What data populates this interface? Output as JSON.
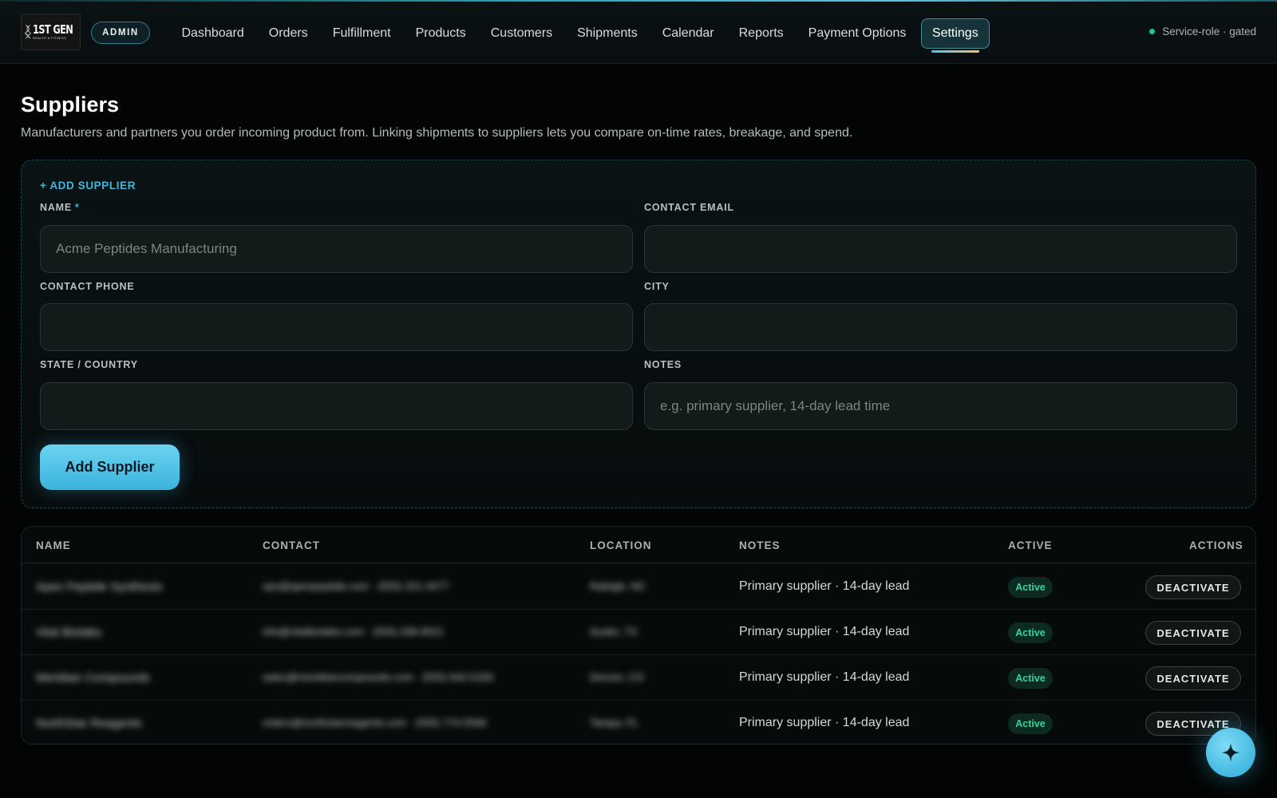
{
  "header": {
    "logo_text": "1ST GEN",
    "logo_sub": "HEALTH & FITNESS",
    "admin_badge": "ADMIN",
    "nav": [
      {
        "label": "Dashboard"
      },
      {
        "label": "Orders"
      },
      {
        "label": "Fulfillment"
      },
      {
        "label": "Products"
      },
      {
        "label": "Customers"
      },
      {
        "label": "Shipments"
      },
      {
        "label": "Calendar"
      },
      {
        "label": "Reports"
      },
      {
        "label": "Payment Options"
      },
      {
        "label": "Settings",
        "active": true
      }
    ],
    "service_status": "Service-role · gated"
  },
  "page": {
    "title": "Suppliers",
    "description": "Manufacturers and partners you order incoming product from. Linking shipments to suppliers lets you compare on-time rates, breakage, and spend."
  },
  "add_form": {
    "heading": "+ ADD SUPPLIER",
    "fields": {
      "name": {
        "label": "NAME",
        "required_mark": "*",
        "placeholder": "Acme Peptides Manufacturing",
        "value": ""
      },
      "contact_email": {
        "label": "CONTACT EMAIL",
        "placeholder": "",
        "value": ""
      },
      "contact_phone": {
        "label": "CONTACT PHONE",
        "placeholder": "",
        "value": ""
      },
      "city": {
        "label": "CITY",
        "placeholder": "",
        "value": ""
      },
      "state_country": {
        "label": "STATE / COUNTRY",
        "placeholder": "",
        "value": ""
      },
      "notes": {
        "label": "NOTES",
        "placeholder": "e.g. primary supplier, 14-day lead time",
        "value": ""
      }
    },
    "submit_label": "Add Supplier"
  },
  "table": {
    "columns": [
      "NAME",
      "CONTACT",
      "LOCATION",
      "NOTES",
      "ACTIVE",
      "ACTIONS"
    ],
    "rows": [
      {
        "name": "Apex Peptide Synthesis",
        "contact": "ops@apexpeptide.com · (555) 201-4477",
        "location": "Raleigh, NC",
        "notes": "Primary supplier · 14-day lead",
        "active": "Active",
        "action": "DEACTIVATE"
      },
      {
        "name": "Vital Biolabs",
        "contact": "info@vitalbiolabs.com · (555) 338-9021",
        "location": "Austin, TX",
        "notes": "Primary supplier · 14-day lead",
        "active": "Active",
        "action": "DEACTIVATE"
      },
      {
        "name": "Meridian Compounds",
        "contact": "sales@meridiancompounds.com · (555) 642-0183",
        "location": "Denver, CO",
        "notes": "Primary supplier · 14-day lead",
        "active": "Active",
        "action": "DEACTIVATE"
      },
      {
        "name": "NorthStar Reagents",
        "contact": "orders@northstarreagents.com · (555) 774-5566",
        "location": "Tampa, FL",
        "notes": "Primary supplier · 14-day lead",
        "active": "Active",
        "action": "DEACTIVATE"
      }
    ]
  },
  "colors": {
    "accent": "#3fb8dc",
    "active_status": "#37d39c",
    "background": "#030404"
  },
  "icons": {
    "logo": "dna-helix-icon",
    "fab": "sparkle-icon",
    "status_dot": "status-dot-icon"
  }
}
